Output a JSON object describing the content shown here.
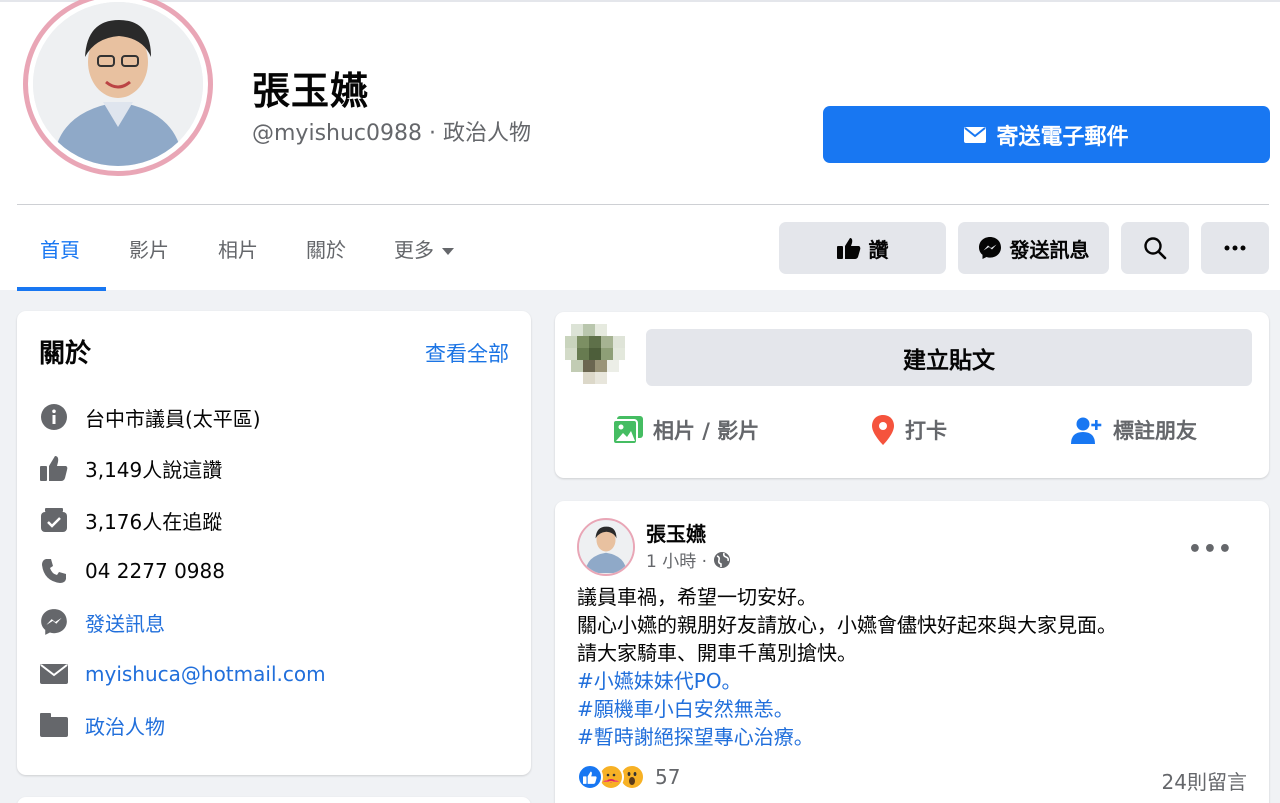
{
  "profile": {
    "name": "張玉嬿",
    "handle": "@myishuc0988 · 政治人物",
    "email_button": "寄送電子郵件"
  },
  "tabs": [
    {
      "label": "首頁",
      "active": true
    },
    {
      "label": "影片"
    },
    {
      "label": "相片"
    },
    {
      "label": "關於"
    },
    {
      "label": "更多"
    }
  ],
  "actions": {
    "like": "讚",
    "message": "發送訊息",
    "search_icon": "search-icon",
    "more_icon": "more-icon"
  },
  "about": {
    "title": "關於",
    "see_all": "查看全部",
    "items": [
      {
        "icon": "info-icon",
        "text": "台中市議員(太平區)"
      },
      {
        "icon": "like-icon",
        "text": "3,149人說這讚"
      },
      {
        "icon": "follow-icon",
        "text": "3,176人在追蹤"
      },
      {
        "icon": "phone-icon",
        "text": "04 2277 0988"
      },
      {
        "icon": "messenger-icon",
        "text": "發送訊息"
      },
      {
        "icon": "email-icon",
        "text": "myishuca@hotmail.com"
      },
      {
        "icon": "category-icon",
        "text": "政治人物"
      }
    ]
  },
  "composer": {
    "placeholder": "建立貼文",
    "photo_video": "相片 / 影片",
    "check_in": "打卡",
    "tag_friends": "標註朋友"
  },
  "post": {
    "author": "張玉嬿",
    "time": "1 小時 ·",
    "lines": [
      "議員車禍，希望一切安好。",
      "關心小嬿的親朋好友請放心，小嬿會儘快好起來與大家見面。",
      "請大家騎車、開車千萬別搶快。"
    ],
    "hashtags": [
      "#小嬿妹妹代PO。",
      "#願機車小白安然無恙。",
      "#暫時謝絕探望專心治療。"
    ],
    "reaction_count": "57",
    "comments": "24則留言"
  },
  "colors": {
    "accent": "#1877f2",
    "link": "#216fdb",
    "avatar_ring": "#e9a6b6"
  }
}
